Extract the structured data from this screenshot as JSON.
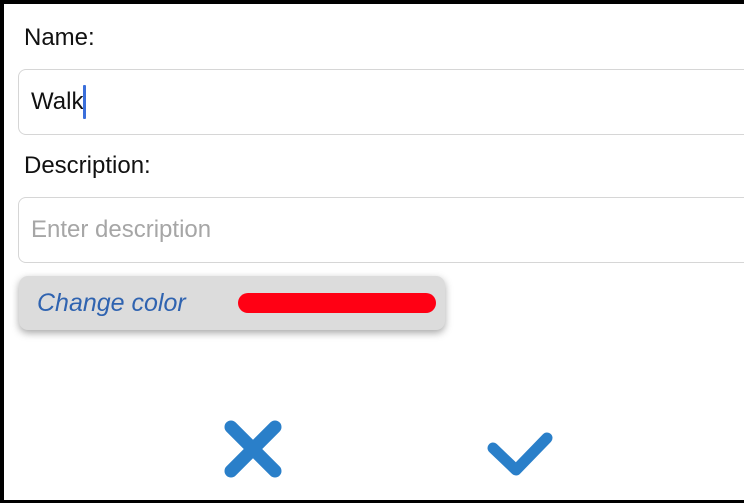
{
  "form": {
    "name_label": "Name:",
    "name_value": "Walk",
    "description_label": "Description:",
    "description_placeholder": "Enter description",
    "description_value": ""
  },
  "color_button": {
    "label": "Change color",
    "swatch_color": "#ff0014"
  },
  "actions": {
    "cancel_icon": "close-icon",
    "confirm_icon": "checkmark-icon",
    "accent_color": "#2a7fc9"
  }
}
